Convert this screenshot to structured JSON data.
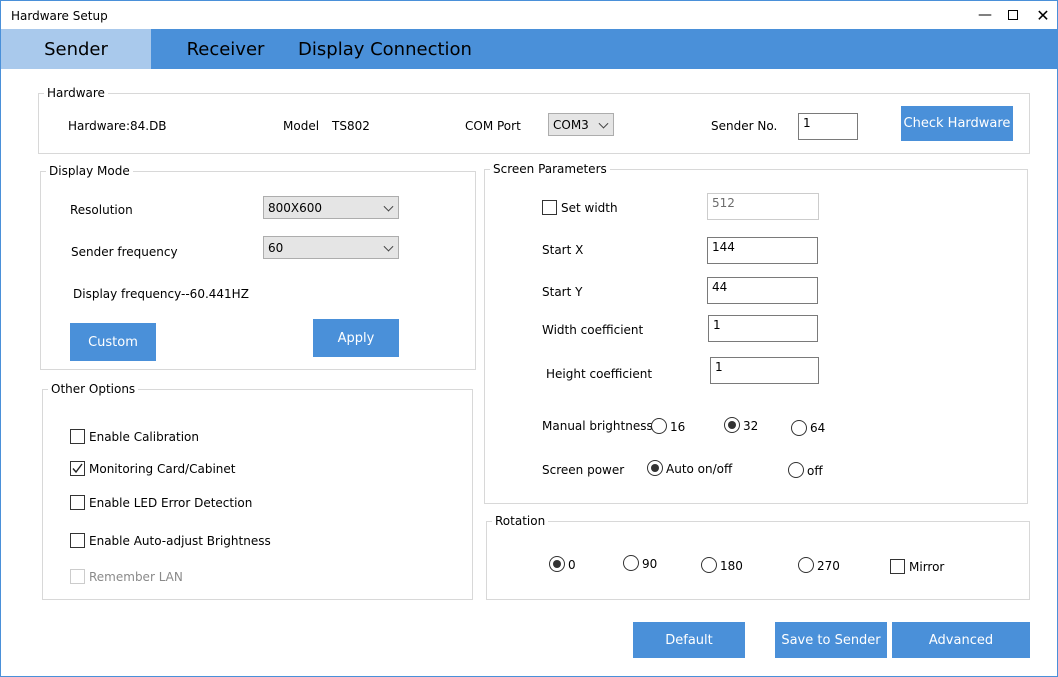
{
  "window": {
    "title": "Hardware Setup"
  },
  "tabs": [
    {
      "label": "Sender",
      "active": true
    },
    {
      "label": "Receiver",
      "active": false
    },
    {
      "label": "Display Connection",
      "active": false
    }
  ],
  "hardware": {
    "legend": "Hardware",
    "hardware_text": "Hardware:84.DB",
    "model_label": "Model",
    "model_value": "TS802",
    "com_port_label": "COM Port",
    "com_port_value": "COM3",
    "sender_no_label": "Sender No.",
    "sender_no_value": "1",
    "check_button": "Check Hardware"
  },
  "display_mode": {
    "legend": "Display Mode",
    "resolution_label": "Resolution",
    "resolution_value": "800X600",
    "frequency_label": "Sender frequency",
    "frequency_value": "60",
    "display_frequency": "Display frequency--60.441HZ",
    "custom_button": "Custom",
    "apply_button": "Apply"
  },
  "other_options": {
    "legend": "Other Options",
    "items": [
      {
        "label": "Enable Calibration",
        "checked": false,
        "enabled": true
      },
      {
        "label": "Monitoring Card/Cabinet",
        "checked": true,
        "enabled": true
      },
      {
        "label": "Enable LED Error Detection",
        "checked": false,
        "enabled": true
      },
      {
        "label": "Enable Auto-adjust Brightness",
        "checked": false,
        "enabled": true
      },
      {
        "label": "Remember LAN",
        "checked": false,
        "enabled": false
      }
    ]
  },
  "screen_params": {
    "legend": "Screen Parameters",
    "set_width_label": "Set width",
    "set_width_checked": false,
    "width_value": "512",
    "start_x_label": "Start X",
    "start_x_value": "144",
    "start_y_label": "Start Y",
    "start_y_value": "44",
    "width_coef_label": "Width coefficient",
    "width_coef_value": "1",
    "height_coef_label": "Height coefficient",
    "height_coef_value": "1",
    "brightness_label": "Manual brightness:",
    "brightness_options": [
      "16",
      "32",
      "64"
    ],
    "brightness_selected": "32",
    "power_label": "Screen power",
    "power_options": [
      "Auto on/off",
      "off"
    ],
    "power_selected": "Auto on/off"
  },
  "rotation": {
    "legend": "Rotation",
    "options": [
      "0",
      "90",
      "180",
      "270"
    ],
    "selected": "0",
    "mirror_label": "Mirror",
    "mirror_checked": false
  },
  "footer": {
    "default_button": "Default",
    "save_button": "Save to Sender",
    "advanced_button": "Advanced"
  },
  "colors": {
    "accent": "#4a90d9",
    "active_tab": "#a9c9ec"
  }
}
